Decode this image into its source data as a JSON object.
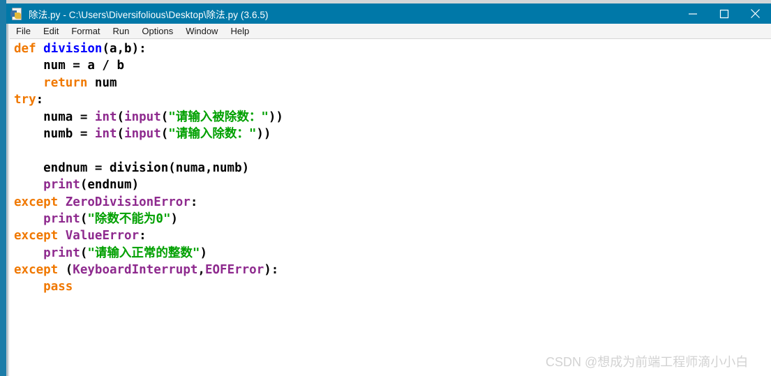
{
  "window": {
    "title": "除法.py - C:\\Users\\Diversifolious\\Desktop\\除法.py (3.6.5)",
    "icon": "python-file-icon",
    "controls": {
      "minimize": "minimize-icon",
      "maximize": "maximize-icon",
      "close": "close-icon"
    },
    "titlebar_color": "#0078a8",
    "frame_color": "#1b7ca8"
  },
  "menubar": {
    "items": [
      {
        "label": "File"
      },
      {
        "label": "Edit"
      },
      {
        "label": "Format"
      },
      {
        "label": "Run"
      },
      {
        "label": "Options"
      },
      {
        "label": "Window"
      },
      {
        "label": "Help"
      }
    ]
  },
  "editor": {
    "language": "python",
    "syntax_colors": {
      "keyword": "#f07800",
      "definition": "#0000ff",
      "builtin": "#8e2a8e",
      "string": "#00a000",
      "plain": "#000000",
      "background": "#ffffff"
    },
    "lines": [
      {
        "n": 1,
        "text": "def division(a,b):",
        "tokens": [
          {
            "t": "def",
            "c": "kw"
          },
          {
            "t": " ",
            "c": "pl"
          },
          {
            "t": "division",
            "c": "fn"
          },
          {
            "t": "(a,b):",
            "c": "pl"
          }
        ]
      },
      {
        "n": 2,
        "text": "    num = a / b",
        "tokens": [
          {
            "t": "    num = a / b",
            "c": "pl"
          }
        ]
      },
      {
        "n": 3,
        "text": "    return num",
        "tokens": [
          {
            "t": "    ",
            "c": "pl"
          },
          {
            "t": "return",
            "c": "kw"
          },
          {
            "t": " num",
            "c": "pl"
          }
        ]
      },
      {
        "n": 4,
        "text": "try:",
        "tokens": [
          {
            "t": "try",
            "c": "kw"
          },
          {
            "t": ":",
            "c": "pl"
          }
        ]
      },
      {
        "n": 5,
        "text": "    numa = int(input(\"请输入被除数：\"))",
        "tokens": [
          {
            "t": "    numa = ",
            "c": "pl"
          },
          {
            "t": "int",
            "c": "bi"
          },
          {
            "t": "(",
            "c": "pl"
          },
          {
            "t": "input",
            "c": "bi"
          },
          {
            "t": "(",
            "c": "pl"
          },
          {
            "t": "\"请输入被除数：\"",
            "c": "str"
          },
          {
            "t": "))",
            "c": "pl"
          }
        ]
      },
      {
        "n": 6,
        "text": "    numb = int(input(\"请输入除数：\"))",
        "tokens": [
          {
            "t": "    numb = ",
            "c": "pl"
          },
          {
            "t": "int",
            "c": "bi"
          },
          {
            "t": "(",
            "c": "pl"
          },
          {
            "t": "input",
            "c": "bi"
          },
          {
            "t": "(",
            "c": "pl"
          },
          {
            "t": "\"请输入除数：\"",
            "c": "str"
          },
          {
            "t": "))",
            "c": "pl"
          }
        ]
      },
      {
        "n": 7,
        "text": "",
        "tokens": [
          {
            "t": " ",
            "c": "pl"
          }
        ]
      },
      {
        "n": 8,
        "text": "    endnum = division(numa,numb)",
        "tokens": [
          {
            "t": "    endnum = division(numa,numb)",
            "c": "pl"
          }
        ]
      },
      {
        "n": 9,
        "text": "    print(endnum)",
        "tokens": [
          {
            "t": "    ",
            "c": "pl"
          },
          {
            "t": "print",
            "c": "bi"
          },
          {
            "t": "(endnum)",
            "c": "pl"
          }
        ]
      },
      {
        "n": 10,
        "text": "except ZeroDivisionError:",
        "tokens": [
          {
            "t": "except",
            "c": "kw"
          },
          {
            "t": " ",
            "c": "pl"
          },
          {
            "t": "ZeroDivisionError",
            "c": "bi"
          },
          {
            "t": ":",
            "c": "pl"
          }
        ]
      },
      {
        "n": 11,
        "text": "    print(\"除数不能为0\")",
        "tokens": [
          {
            "t": "    ",
            "c": "pl"
          },
          {
            "t": "print",
            "c": "bi"
          },
          {
            "t": "(",
            "c": "pl"
          },
          {
            "t": "\"除数不能为0\"",
            "c": "str"
          },
          {
            "t": ")",
            "c": "pl"
          }
        ]
      },
      {
        "n": 12,
        "text": "except ValueError:",
        "tokens": [
          {
            "t": "except",
            "c": "kw"
          },
          {
            "t": " ",
            "c": "pl"
          },
          {
            "t": "ValueError",
            "c": "bi"
          },
          {
            "t": ":",
            "c": "pl"
          }
        ]
      },
      {
        "n": 13,
        "text": "    print(\"请输入正常的整数\")",
        "tokens": [
          {
            "t": "    ",
            "c": "pl"
          },
          {
            "t": "print",
            "c": "bi"
          },
          {
            "t": "(",
            "c": "pl"
          },
          {
            "t": "\"请输入正常的整数\"",
            "c": "str"
          },
          {
            "t": ")",
            "c": "pl"
          }
        ]
      },
      {
        "n": 14,
        "text": "except (KeyboardInterrupt,EOFError):",
        "tokens": [
          {
            "t": "except",
            "c": "kw"
          },
          {
            "t": " (",
            "c": "pl"
          },
          {
            "t": "KeyboardInterrupt",
            "c": "bi"
          },
          {
            "t": ",",
            "c": "pl"
          },
          {
            "t": "EOFError",
            "c": "bi"
          },
          {
            "t": "):",
            "c": "pl"
          }
        ]
      },
      {
        "n": 15,
        "text": "    pass",
        "tokens": [
          {
            "t": "    ",
            "c": "pl"
          },
          {
            "t": "pass",
            "c": "kw"
          }
        ]
      }
    ]
  },
  "watermark": {
    "text": "CSDN @想成为前端工程师滴小小白",
    "color": "#d2d2d2"
  }
}
